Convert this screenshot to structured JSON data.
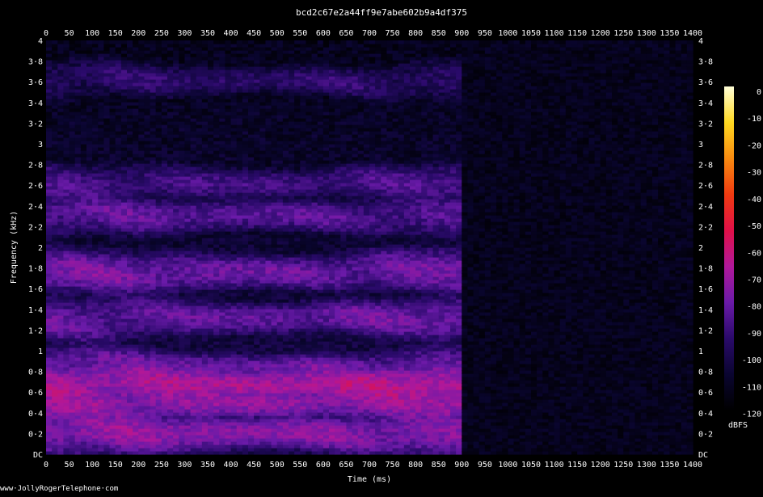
{
  "chart_data": {
    "type": "heatmap",
    "title": "bcd2c67e2a44ff9e7abe602b9a4df375",
    "xlabel": "Time (ms)",
    "ylabel": "Frequency (kHz)",
    "xlim": [
      0,
      1400
    ],
    "ylim": [
      0,
      4
    ],
    "x_ticks": [
      "0",
      "50",
      "100",
      "150",
      "200",
      "250",
      "300",
      "350",
      "400",
      "450",
      "500",
      "550",
      "600",
      "650",
      "700",
      "750",
      "800",
      "850",
      "900",
      "950",
      "1000",
      "1050",
      "1100",
      "1150",
      "1200",
      "1250",
      "1300",
      "1350",
      "1400"
    ],
    "y_ticks": [
      "DC",
      "0·2",
      "0·4",
      "0·6",
      "0·8",
      "1",
      "1·2",
      "1·4",
      "1·6",
      "1·8",
      "2",
      "2·2",
      "2·4",
      "2·6",
      "2·8",
      "3",
      "3·2",
      "3·4",
      "3·6",
      "3·8",
      "4"
    ],
    "colorbar": {
      "label": "dBFS",
      "ticks": [
        "0",
        "-10",
        "-20",
        "-30",
        "-40",
        "-50",
        "-60",
        "-70",
        "-80",
        "-90",
        "-100",
        "-110",
        "-120"
      ],
      "range": [
        -120,
        0
      ],
      "colors": [
        "#000000",
        "#0a0530",
        "#2a0a6a",
        "#6a1aa8",
        "#b0189a",
        "#e01048",
        "#f03a10",
        "#f88a10",
        "#ffd820",
        "#ffffd8"
      ]
    },
    "signal_end_ms": 900,
    "energy_bands_khz": [
      {
        "center": 0.2,
        "level_dbfs": -75
      },
      {
        "center": 0.5,
        "level_dbfs": -72
      },
      {
        "center": 0.65,
        "level_dbfs": -68
      },
      {
        "center": 0.8,
        "level_dbfs": -80
      },
      {
        "center": 1.3,
        "level_dbfs": -82
      },
      {
        "center": 1.75,
        "level_dbfs": -80
      },
      {
        "center": 2.3,
        "level_dbfs": -85
      },
      {
        "center": 2.6,
        "level_dbfs": -88
      },
      {
        "center": 3.6,
        "level_dbfs": -95
      }
    ]
  },
  "footer": "www·JollyRogerTelephone·com"
}
